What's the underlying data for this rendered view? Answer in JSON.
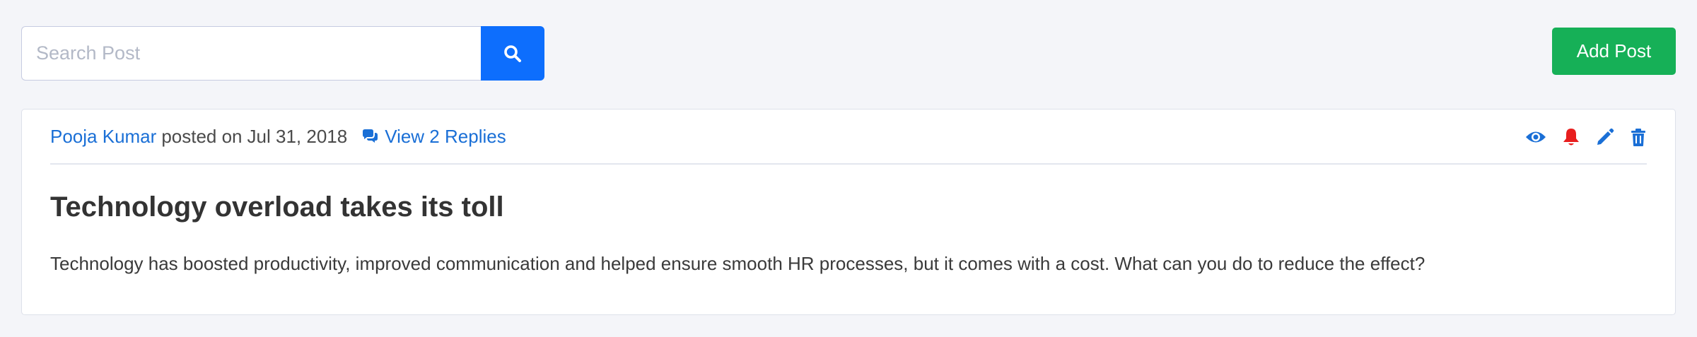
{
  "search": {
    "placeholder": "Search Post",
    "value": ""
  },
  "toolbar": {
    "add_post_label": "Add Post"
  },
  "post": {
    "author": "Pooja Kumar",
    "posted_prefix": "posted on",
    "date": "Jul 31, 2018",
    "replies_label": "View 2 Replies",
    "title": "Technology overload takes its toll",
    "body": "Technology has boosted productivity, improved communication and helped ensure smooth HR processes, but it comes with a cost. What can you do to reduce the effect?",
    "actions": [
      {
        "icon": "eye-icon",
        "color": "#1a6fd6"
      },
      {
        "icon": "bell-icon",
        "color": "#e81e1e"
      },
      {
        "icon": "pencil-icon",
        "color": "#1a6fd6"
      },
      {
        "icon": "trash-icon",
        "color": "#1a6fd6"
      }
    ]
  },
  "colors": {
    "background": "#f4f5f9",
    "primary": "#0d6efd",
    "success": "#16b057",
    "link": "#1a6fd6",
    "danger": "#e81e1e"
  }
}
